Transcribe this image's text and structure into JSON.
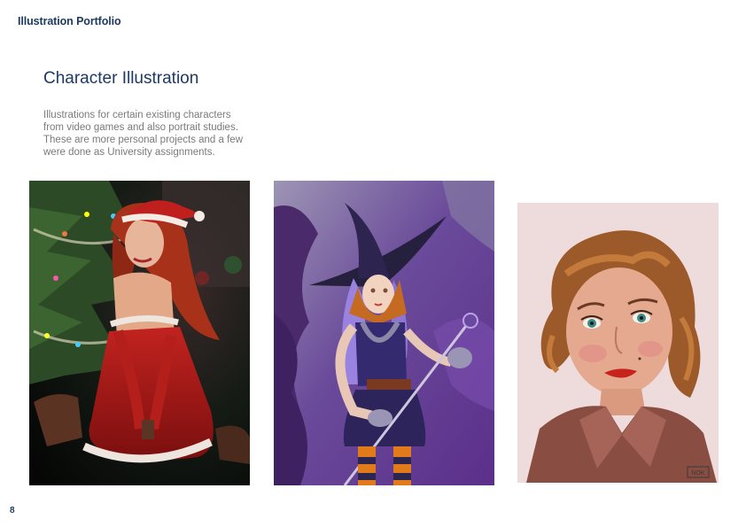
{
  "header": {
    "title": "Illustration Portfolio"
  },
  "section": {
    "title": "Character Illustration",
    "description": [
      "Illustrations for certain existing characters",
      "from video games and also portrait studies.",
      "These are more personal projects and a few",
      "were done as  University assignments."
    ]
  },
  "artworks": [
    {
      "name": "santa-character-illustration"
    },
    {
      "name": "witch-character-illustration"
    },
    {
      "name": "vintage-portrait-study",
      "signature": "NOK"
    }
  ],
  "footer": {
    "page_number": "8"
  },
  "colors": {
    "brand_navy": "#1d3a63",
    "body_gray": "#7a7a7a"
  }
}
